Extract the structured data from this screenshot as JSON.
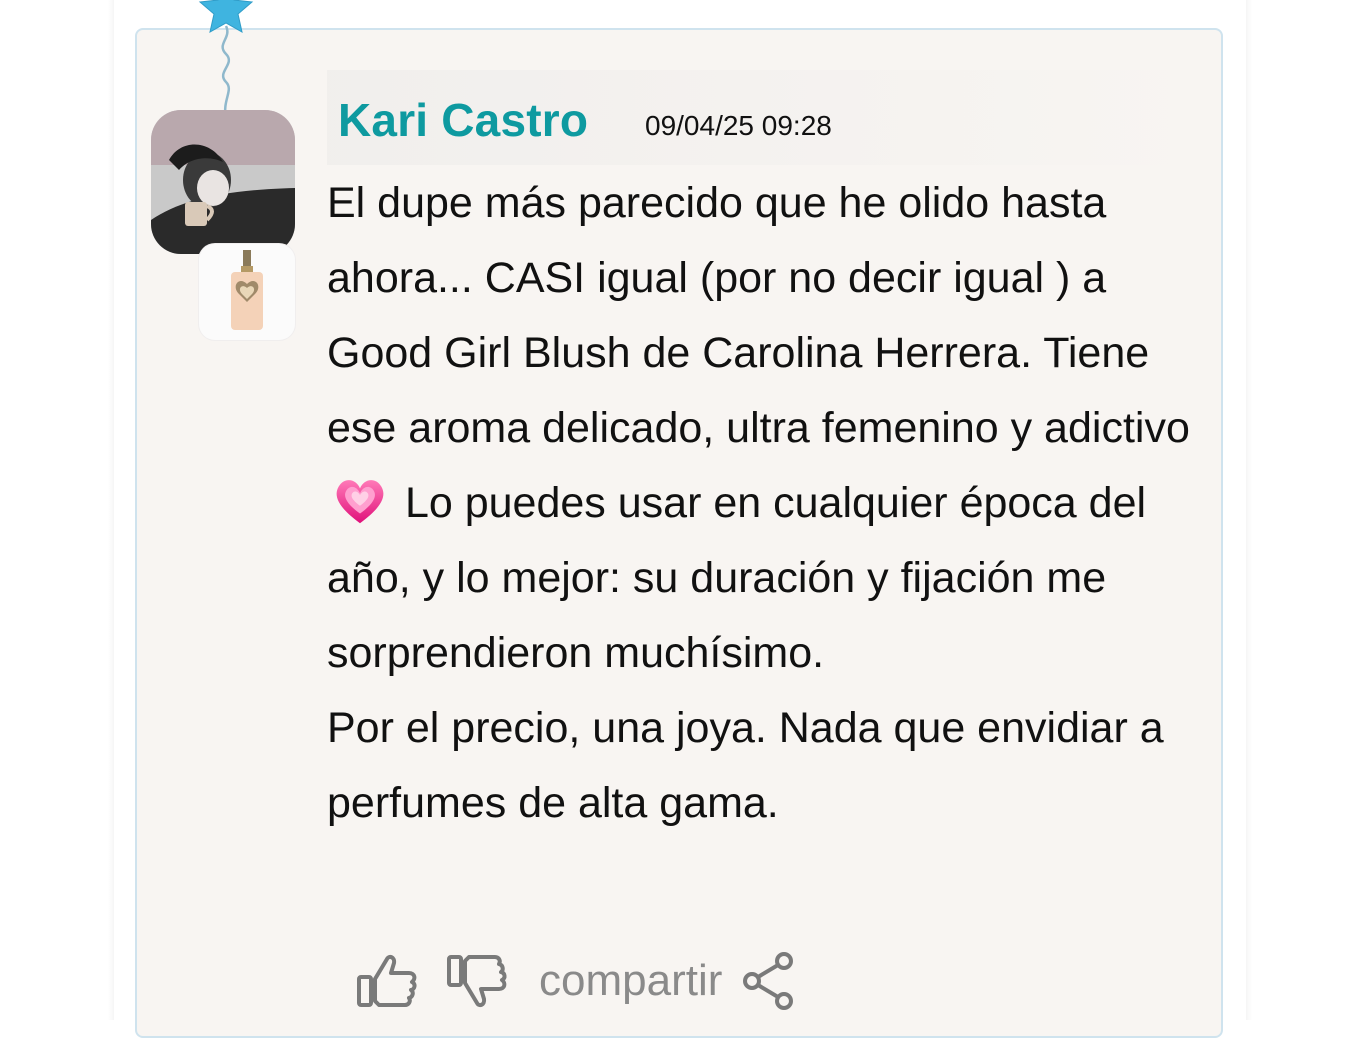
{
  "comment": {
    "author": "Kari Castro",
    "date": "09/04/25 09:28",
    "paragraphs": [
      "El dupe más parecido que he olido hasta ahora... CASI igual (por no decir igual ) a Good Girl Blush de Carolina Herrera. Tiene ese aroma delicado, ultra femenino y adictivo",
      "Lo puedes usar en cualquier época del año, y lo mejor: su duración y fijación me sorprendieron muchísimo.",
      "Por el precio, una joya. Nada que envidiar a perfumes de alta gama."
    ],
    "emoji": "sparkling-heart-emoji"
  },
  "actions": {
    "like_icon": "thumbs-up-icon",
    "dislike_icon": "thumbs-down-icon",
    "share_label": "compartir",
    "share_icon": "share-icon"
  },
  "colors": {
    "author": "#0e9aa0",
    "card_bg": "#f8f5f2",
    "card_border": "#cfe3ee",
    "action_gray": "#8a8a8a"
  }
}
